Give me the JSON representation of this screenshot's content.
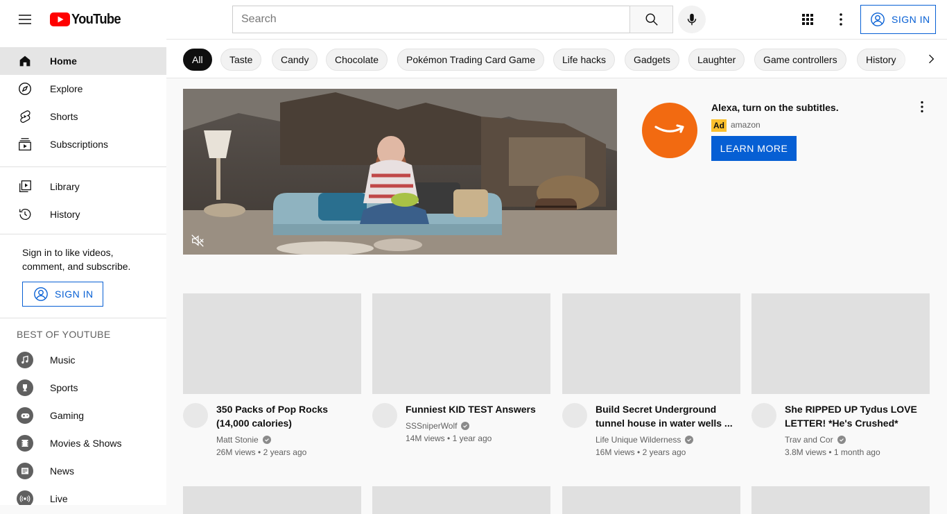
{
  "header": {
    "logo_text": "YouTube",
    "search_placeholder": "Search",
    "sign_in_label": "SIGN IN"
  },
  "chips": [
    "All",
    "Taste",
    "Candy",
    "Chocolate",
    "Pokémon Trading Card Game",
    "Life hacks",
    "Gadgets",
    "Laughter",
    "Game controllers",
    "History"
  ],
  "sidebar": {
    "primary": [
      {
        "label": "Home",
        "icon": "home-icon",
        "active": true
      },
      {
        "label": "Explore",
        "icon": "compass-icon"
      },
      {
        "label": "Shorts",
        "icon": "shorts-icon"
      },
      {
        "label": "Subscriptions",
        "icon": "subscriptions-icon"
      }
    ],
    "secondary": [
      {
        "label": "Library",
        "icon": "library-icon"
      },
      {
        "label": "History",
        "icon": "history-icon"
      }
    ],
    "signin_prompt": "Sign in to like videos, comment, and subscribe.",
    "signin_label": "SIGN IN",
    "best_heading": "BEST OF YOUTUBE",
    "best": [
      {
        "label": "Music",
        "icon": "music-icon"
      },
      {
        "label": "Sports",
        "icon": "trophy-icon"
      },
      {
        "label": "Gaming",
        "icon": "gaming-icon"
      },
      {
        "label": "Movies & Shows",
        "icon": "movies-icon"
      },
      {
        "label": "News",
        "icon": "news-icon"
      },
      {
        "label": "Live",
        "icon": "live-icon"
      }
    ]
  },
  "ad": {
    "title": "Alexa, turn on the subtitles.",
    "badge": "Ad",
    "advertiser": "amazon",
    "cta": "LEARN MORE",
    "brand_color": "#f26a11"
  },
  "videos": [
    {
      "title": "350 Packs of Pop Rocks (14,000 calories)",
      "channel": "Matt Stonie",
      "views": "26M views",
      "age": "2 years ago",
      "verified": true
    },
    {
      "title": "Funniest KID TEST Answers",
      "channel": "SSSniperWolf",
      "views": "14M views",
      "age": "1 year ago",
      "verified": true
    },
    {
      "title": "Build Secret Underground tunnel house in water wells ...",
      "channel": "Life Unique Wilderness",
      "views": "16M views",
      "age": "2 years ago",
      "verified": true
    },
    {
      "title": "She RIPPED UP Tydus LOVE LETTER! *He's Crushed*",
      "channel": "Trav and Cor",
      "views": "3.8M views",
      "age": "1 month ago",
      "verified": true
    }
  ],
  "meta_separator": "•",
  "colors": {
    "accent": "#065fd4",
    "brand_red": "#ff0000",
    "ad_badge": "#fbc02d"
  }
}
